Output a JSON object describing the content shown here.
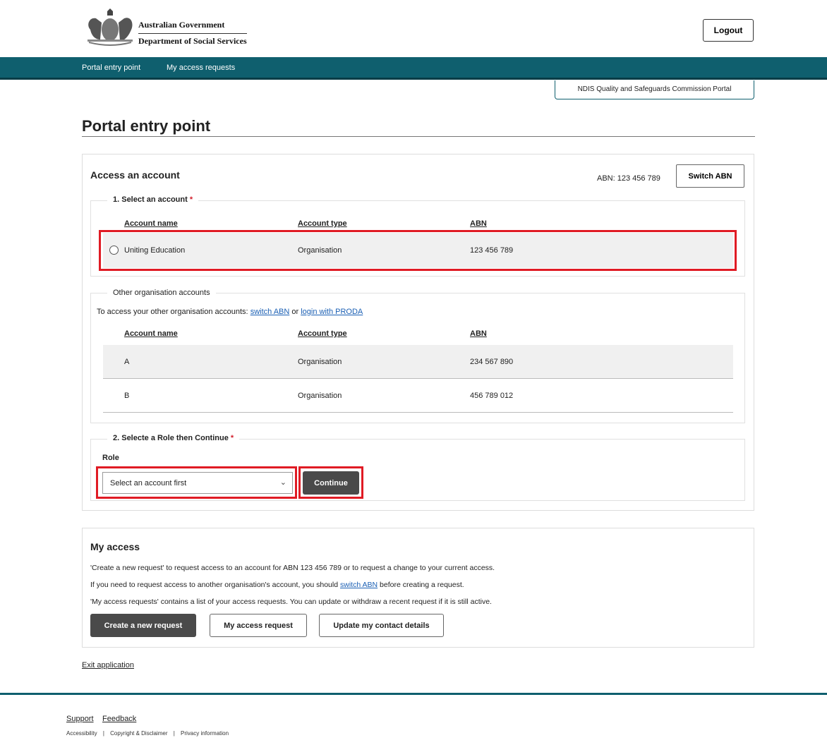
{
  "header": {
    "gov_line1": "Australian Government",
    "gov_line2": "Department of Social Services",
    "logout_label": "Logout"
  },
  "nav": {
    "items": [
      "Portal entry point",
      "My access requests"
    ]
  },
  "portal_tag": "NDIS Quality and Safeguards Commission Portal",
  "page_title": "Portal entry point",
  "access": {
    "heading": "Access an account",
    "abn_text": "ABN: 123 456 789",
    "switch_abn_label": "Switch ABN",
    "select_account": {
      "legend": "1. Select an account",
      "required_mark": "*",
      "columns": [
        "Account name",
        "Account type",
        "ABN"
      ],
      "rows": [
        {
          "name": "Uniting Education",
          "type": "Organisation",
          "abn": "123 456 789"
        }
      ]
    },
    "other_accounts": {
      "legend": "Other organisation accounts",
      "helper_prefix": "To access your other organisation accounts:",
      "switch_link": "switch ABN",
      "or_text": "or",
      "proda_link": "login with PRODA",
      "columns": [
        "Account name",
        "Account type",
        "ABN"
      ],
      "rows": [
        {
          "name": "A",
          "type": "Organisation",
          "abn": "234 567 890"
        },
        {
          "name": "B",
          "type": "Organisation",
          "abn": "456 789 012"
        }
      ]
    },
    "role": {
      "legend": "2. Selecte a Role then Continue",
      "required_mark": "*",
      "label": "Role",
      "select_value": "Select an account first",
      "continue_label": "Continue"
    }
  },
  "my_access": {
    "heading": "My access",
    "line1": "'Create a new request' to request access to an account for ABN 123 456 789 or to request a change to your current access.",
    "line2_prefix": "If you need to request access to another organisation's account, you should",
    "line2_link": "switch ABN",
    "line2_suffix": "before creating a request.",
    "line3": "'My access requests' contains a list of your access requests. You can update or withdraw a recent request if it is still active.",
    "buttons": {
      "create": "Create a new request",
      "my_requests": "My access request",
      "update_contact": "Update my contact details"
    }
  },
  "exit_label": "Exit application",
  "footer": {
    "links": [
      "Support",
      "Feedback"
    ],
    "small_links": [
      "Accessibility",
      "|",
      "Copyright & Disclaimer",
      "|",
      "Privacy information"
    ]
  },
  "colors": {
    "teal": "#0f5f6e",
    "highlight_red": "#e01b24",
    "dark_button": "#4a4a4a"
  }
}
